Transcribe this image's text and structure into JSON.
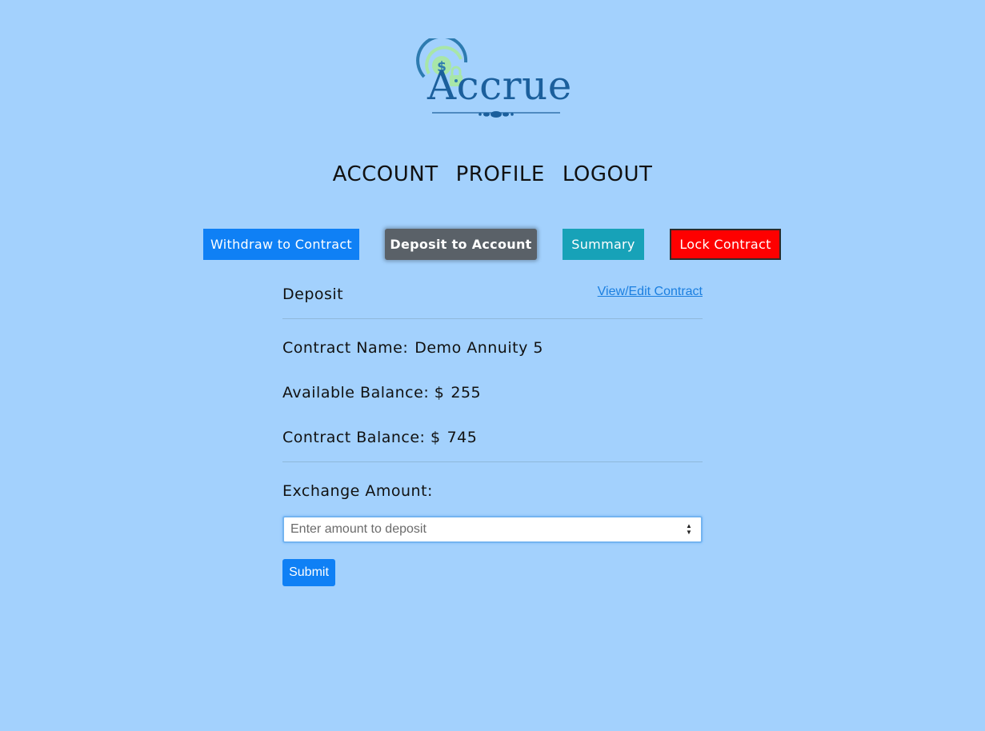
{
  "brand": {
    "name": "Accrue",
    "accent": "#1b5f9c",
    "icon": "dollar-lock-icon"
  },
  "nav": {
    "items": [
      "ACCOUNT",
      "PROFILE",
      "LOGOUT"
    ]
  },
  "actions": {
    "withdraw": "Withdraw to Contract",
    "deposit": "Deposit to Account",
    "summary": "Summary",
    "lock": "Lock Contract",
    "colors": {
      "withdraw": "#0f80f5",
      "deposit": "#5a6168",
      "summary": "#17a2b8",
      "lock": "#fe0000"
    }
  },
  "card": {
    "title": "Deposit",
    "view_edit_link": "View/Edit Contract",
    "contract_name_label": "Contract Name:",
    "contract_name": "Demo Annuity 5",
    "available_balance_label": "Available Balance: $",
    "available_balance": "255",
    "contract_balance_label": "Contract Balance: $",
    "contract_balance": "745",
    "exchange_label": "Exchange Amount:",
    "amount_placeholder": "Enter amount to deposit",
    "submit_label": "Submit"
  }
}
